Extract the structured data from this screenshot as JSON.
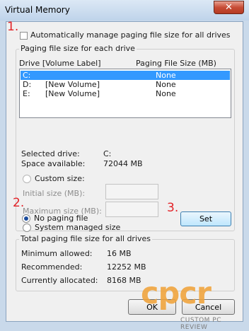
{
  "window": {
    "title": "Virtual Memory",
    "close_label": "✕"
  },
  "auto_manage": {
    "label": "Automatically manage paging file size for all drives",
    "checked": false
  },
  "drives_group": {
    "legend": "Paging file size for each drive",
    "header_drive": "Drive  [Volume Label]",
    "header_size": "Paging File Size (MB)",
    "rows": [
      {
        "drive": "C:",
        "label": "",
        "size": "None",
        "selected": true
      },
      {
        "drive": "D:",
        "label": "[New Volume]",
        "size": "None",
        "selected": false
      },
      {
        "drive": "E:",
        "label": "[New Volume]",
        "size": "None",
        "selected": false
      }
    ],
    "selected_drive_label": "Selected drive:",
    "selected_drive_value": "C:",
    "space_label": "Space available:",
    "space_value": "72044 MB",
    "custom_size_label": "Custom size:",
    "initial_label": "Initial size (MB):",
    "maximum_label": "Maximum size (MB):",
    "system_managed_label": "System managed size",
    "no_paging_label": "No paging file",
    "set_label": "Set"
  },
  "totals_group": {
    "legend": "Total paging file size for all drives",
    "rows": [
      {
        "label": "Minimum allowed:",
        "value": "16 MB"
      },
      {
        "label": "Recommended:",
        "value": "12252 MB"
      },
      {
        "label": "Currently allocated:",
        "value": "8168 MB"
      }
    ]
  },
  "buttons": {
    "ok_label": "OK",
    "cancel_label": "Cancel"
  },
  "annotations": {
    "step1": "1.",
    "step2": "2.",
    "step3": "3."
  },
  "watermark": {
    "logo": "cpcr",
    "tagline": "CUSTOM PC REVIEW"
  },
  "colors": {
    "selection": "#3399ff",
    "annotation": "#e32227",
    "watermark": "#f0a33a"
  }
}
